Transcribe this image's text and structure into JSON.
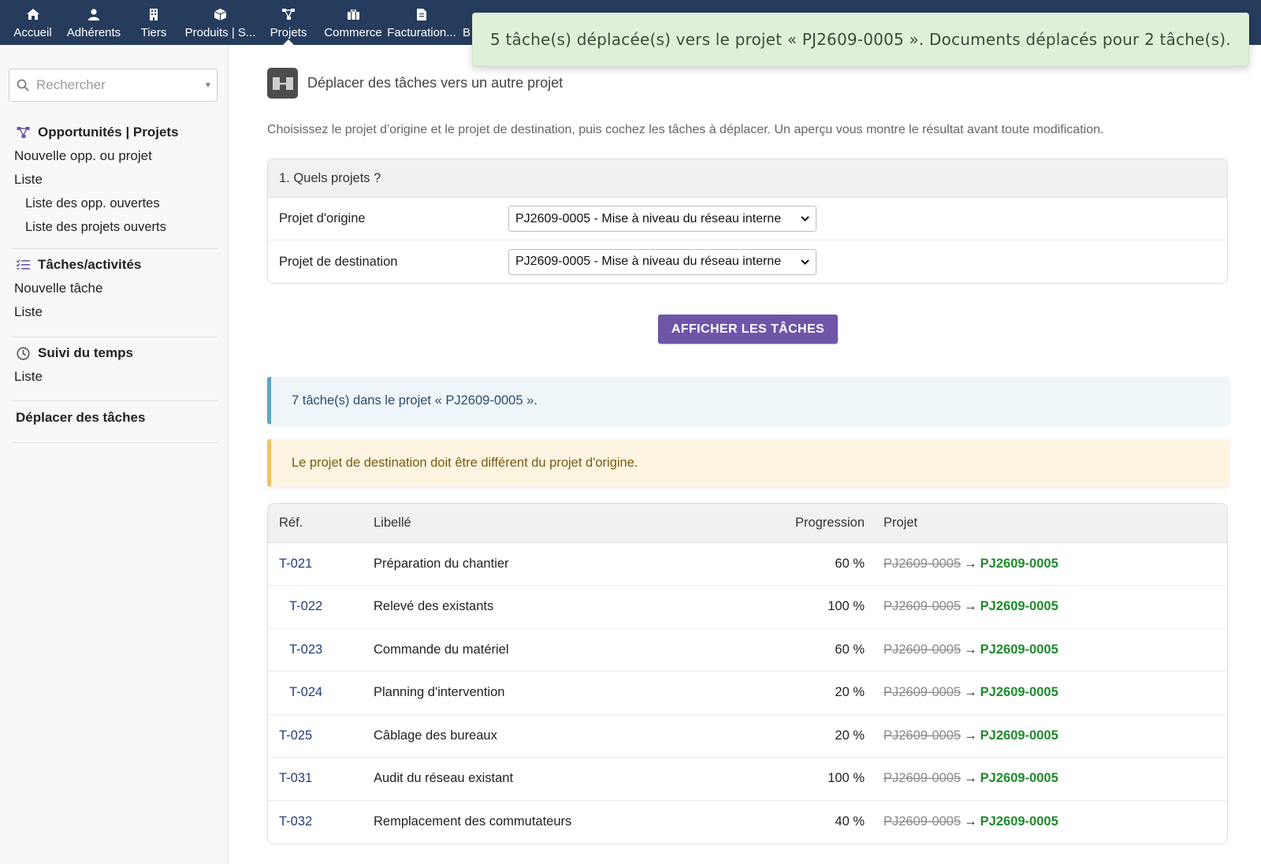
{
  "topbar": {
    "items": [
      {
        "label": "Accueil",
        "icon": "home-icon"
      },
      {
        "label": "Adhérents",
        "icon": "user-icon"
      },
      {
        "label": "Tiers",
        "icon": "building-icon"
      },
      {
        "label": "Produits | S...",
        "icon": "cube-icon"
      },
      {
        "label": "Projets",
        "icon": "project-icon",
        "active": true
      },
      {
        "label": "Commerce",
        "icon": "briefcase-icon"
      },
      {
        "label": "Facturation...",
        "icon": "invoice-icon"
      },
      {
        "label": "B",
        "icon": "bank-icon"
      }
    ],
    "bg_color": "#263c5c"
  },
  "toast": {
    "message": "5 tâche(s) déplacée(s) vers le projet « PJ2609-0005 ». Documents déplacés pour 2 tâche(s)."
  },
  "sidebar": {
    "search_placeholder": "Rechercher",
    "sections": [
      {
        "title": "Opportunités | Projets",
        "icon": "project-icon",
        "links": [
          {
            "label": "Nouvelle opp. ou projet",
            "sub": false
          },
          {
            "label": "Liste",
            "sub": false
          },
          {
            "label": "Liste des opp. ouvertes",
            "sub": true
          },
          {
            "label": "Liste des projets ouverts",
            "sub": true
          }
        ]
      },
      {
        "title": "Tâches/activités",
        "icon": "tasks-icon",
        "links": [
          {
            "label": "Nouvelle tâche",
            "sub": false
          },
          {
            "label": "Liste",
            "sub": false
          }
        ]
      },
      {
        "title": "Suivi du temps",
        "icon": "clock-icon",
        "links": [
          {
            "label": "Liste",
            "sub": false
          }
        ]
      },
      {
        "title": "Déplacer des tâches",
        "icon": "",
        "links": []
      }
    ]
  },
  "page": {
    "title": "Déplacer des tâches vers un autre projet",
    "description": "Choisissez le projet d'origine et le projet de destination, puis cochez les tâches à déplacer. Un aperçu vous montre le résultat avant toute modification."
  },
  "form": {
    "heading": "1. Quels projets ?",
    "origin_label": "Projet d'origine",
    "origin_value": "PJ2609-0005 - Mise à niveau du réseau interne",
    "dest_label": "Projet de destination",
    "dest_value": "PJ2609-0005 - Mise à niveau du réseau interne",
    "button_label": "AFFICHER LES TÂCHES",
    "button_color": "#6e55a8"
  },
  "alerts": {
    "info": "7 tâche(s) dans le projet « PJ2609-0005 ».",
    "warning": "Le projet de destination doit être différent du projet d'origine."
  },
  "table": {
    "headers": {
      "ref": "Réf.",
      "label": "Libellé",
      "progress": "Progression",
      "project": "Projet"
    },
    "arrow": "→",
    "rows": [
      {
        "ref": "T-021",
        "indent": false,
        "label": "Préparation du chantier",
        "progress": "60 %",
        "old_project": "PJ2609-0005",
        "new_project": "PJ2609-0005"
      },
      {
        "ref": "T-022",
        "indent": true,
        "label": "Relevé des existants",
        "progress": "100 %",
        "old_project": "PJ2609-0005",
        "new_project": "PJ2609-0005"
      },
      {
        "ref": "T-023",
        "indent": true,
        "label": "Commande du matériel",
        "progress": "60 %",
        "old_project": "PJ2609-0005",
        "new_project": "PJ2609-0005"
      },
      {
        "ref": "T-024",
        "indent": true,
        "label": "Planning d'intervention",
        "progress": "20 %",
        "old_project": "PJ2609-0005",
        "new_project": "PJ2609-0005"
      },
      {
        "ref": "T-025",
        "indent": false,
        "label": "Câblage des bureaux",
        "progress": "20 %",
        "old_project": "PJ2609-0005",
        "new_project": "PJ2609-0005"
      },
      {
        "ref": "T-031",
        "indent": false,
        "label": "Audit du réseau existant",
        "progress": "100 %",
        "old_project": "PJ2609-0005",
        "new_project": "PJ2609-0005"
      },
      {
        "ref": "T-032",
        "indent": false,
        "label": "Remplacement des commutateurs",
        "progress": "40 %",
        "old_project": "PJ2609-0005",
        "new_project": "PJ2609-0005"
      }
    ]
  }
}
